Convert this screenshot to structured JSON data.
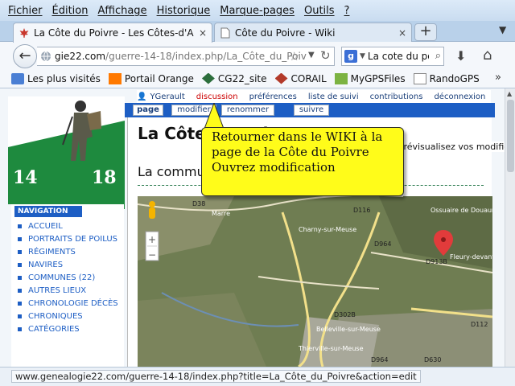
{
  "menubar": {
    "items": [
      "Fichier",
      "Édition",
      "Affichage",
      "Historique",
      "Marque-pages",
      "Outils",
      "?"
    ]
  },
  "tabs": [
    {
      "label": "La Côte du Poivre - Les Côtes-d'Armor ...",
      "active": true,
      "close": "×"
    },
    {
      "label": "Côte du Poivre - Wiki",
      "active": false,
      "close": "×"
    }
  ],
  "newtab_label": "+",
  "tablist_label": "▼",
  "navbar": {
    "url_host": "gie22.com",
    "url_path": "/guerre-14-18/index.php/La_Côte_du_Poivre",
    "search_engine": "g",
    "search_value": "La cote du poivre"
  },
  "bookmarks": {
    "items": [
      "Les plus visités",
      "Portail Orange",
      "CG22_site",
      "CORAIL",
      "MyGPSFiles",
      "RandoGPS"
    ],
    "more": "»"
  },
  "wiki": {
    "logo_left": "14",
    "logo_right": "18",
    "user_links": [
      "YGerault",
      "discussion",
      "préférences",
      "liste de suivi",
      "contributions",
      "déconnexion"
    ],
    "page_tabs": [
      "page",
      "modifier",
      "renommer",
      "suivre"
    ],
    "title": "La Côte du Poivre",
    "tooltip": "Prévisualisez vos modifications, s'il vous plaît, avant d'enregistrer. [alt-shift-p]",
    "subheading": "La commune de La Côte du Poivre",
    "nav_header": "NAVIGATION",
    "nav_items": [
      "ACCUEIL",
      "PORTRAITS DE POILUS",
      "RÉGIMENTS",
      "NAVIRES",
      "COMMUNES (22)",
      "AUTRES LIEUX",
      "CHRONOLOGIE DÉCÈS",
      "CHRONIQUES",
      "CATÉGORIES"
    ]
  },
  "map": {
    "labels": [
      "D38",
      "D116",
      "Marre",
      "Charny-sur-Meuse",
      "D964",
      "Ossuaire de Douaumont",
      "D913B",
      "Fleury-devant-Douaumont",
      "D302B",
      "Belleville-sur-Meuse",
      "Thierville-sur-Meuse",
      "D112",
      "D964",
      "D630"
    ],
    "zoom_in": "+",
    "zoom_out": "−"
  },
  "callout": {
    "line1": "Retourner dans le WIKI à la",
    "line2": "page de la Côte du Poivre",
    "line3": "Ouvrez modification"
  },
  "status": {
    "url": "www.genealogie22.com/guerre-14-18/index.php?title=La_Côte_du_Poivre&action=edit"
  },
  "colors": {
    "wiki_blue": "#1d5ec4",
    "logo_green": "#1e8a3e",
    "callout_yellow": "#fffc1a",
    "marker_red": "#e23b3b"
  }
}
